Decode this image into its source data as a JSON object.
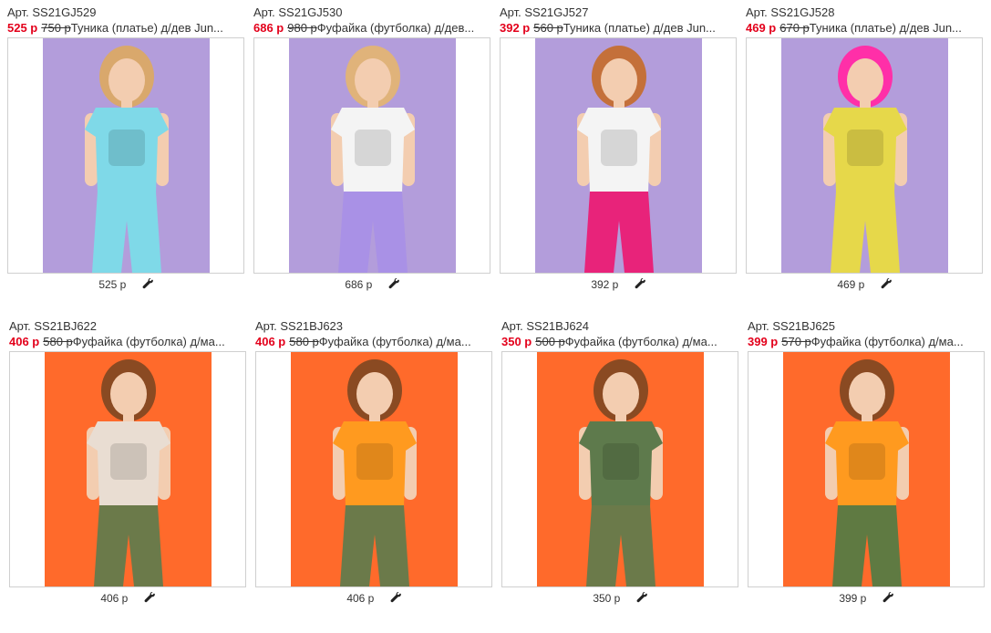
{
  "items": [
    {
      "article": "Арт. SS21GJ529",
      "price": "525 р",
      "old_price": "750 р",
      "title": "Туника (платье) д/дев Jun...",
      "footer_price": "525 р",
      "bg": "#b39ddb",
      "garment": "#7fd9e8",
      "pants": "#7fd9e8",
      "hair": "#d9a86c"
    },
    {
      "article": "Арт. SS21GJ530",
      "price": "686 р",
      "old_price": "980 р",
      "title": "Фуфайка (футболка) д/дев...",
      "footer_price": "686 р",
      "bg": "#b39ddb",
      "garment": "#f4f4f4",
      "pants": "#a991e6",
      "hair": "#e0b37a"
    },
    {
      "article": "Арт. SS21GJ527",
      "price": "392 р",
      "old_price": "560 р",
      "title": "Туника (платье) д/дев Jun...",
      "footer_price": "392 р",
      "bg": "#b39ddb",
      "garment": "#f4f4f4",
      "pants": "#e8237a",
      "hair": "#c4703a"
    },
    {
      "article": "Арт. SS21GJ528",
      "price": "469 р",
      "old_price": "670 р",
      "title": "Туника (платье) д/дев Jun...",
      "footer_price": "469 р",
      "bg": "#b39ddb",
      "garment": "#e6d84a",
      "pants": "#e6d84a",
      "hair": "#ff2fa8"
    },
    {
      "article": "Арт. SS21BJ622",
      "price": "406 р",
      "old_price": "580 р",
      "title": "Фуфайка (футболка) д/ма...",
      "footer_price": "406 р",
      "bg": "#ff6a2b",
      "garment": "#e9ddd2",
      "pants": "#6b7a4a",
      "hair": "#8a4a22"
    },
    {
      "article": "Арт. SS21BJ623",
      "price": "406 р",
      "old_price": "580 р",
      "title": "Фуфайка (футболка) д/ма...",
      "footer_price": "406 р",
      "bg": "#ff6a2b",
      "garment": "#ff9a1f",
      "pants": "#6b7a4a",
      "hair": "#8a4a22"
    },
    {
      "article": "Арт. SS21BJ624",
      "price": "350 р",
      "old_price": "500 р",
      "title": "Фуфайка (футболка) д/ма...",
      "footer_price": "350 р",
      "bg": "#ff6a2b",
      "garment": "#5e7a4c",
      "pants": "#6b7a4a",
      "hair": "#8a4a22"
    },
    {
      "article": "Арт. SS21BJ625",
      "price": "399 р",
      "old_price": "570 р",
      "title": "Фуфайка (футболка) д/ма...",
      "footer_price": "399 р",
      "bg": "#ff6a2b",
      "garment": "#ff9a1f",
      "pants": "#5f7a42",
      "hair": "#8a4a22"
    }
  ],
  "icons": {
    "settings": "wrench-icon"
  },
  "colors": {
    "sale_price": "#e3001b",
    "border": "#cfcfcf"
  }
}
